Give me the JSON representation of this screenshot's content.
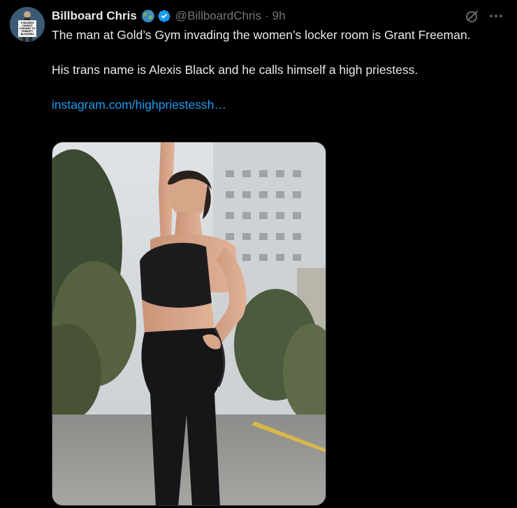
{
  "author": {
    "display_name": "Billboard Chris",
    "handle": "@BillboardChris",
    "separator": "·",
    "time": "9h",
    "badge_icon": "globe-emoji-icon",
    "verified_icon": "verified-badge-icon",
    "verified_color": "#1d9bf0"
  },
  "avatar_sign_lines": [
    "CHILDREN",
    "CANNOT",
    "CONSENT TO",
    "PUBERTY",
    "BLOCKERS"
  ],
  "tweet": {
    "text_line1": "The man at Gold’s Gym invading the women’s locker room is Grant Freeman.",
    "text_line2": "His trans name is Alexis Black and he calls himself a high priestess.",
    "link_text": "instagram.com/highpriestessh…"
  },
  "actions": {
    "grok_icon": "grok-icon",
    "more_icon": "more-options-icon"
  },
  "media": {
    "description_icon": "photo"
  },
  "colors": {
    "background": "#000000",
    "text": "#e7e9ea",
    "secondary": "#71767b",
    "link": "#1d9bf0"
  }
}
